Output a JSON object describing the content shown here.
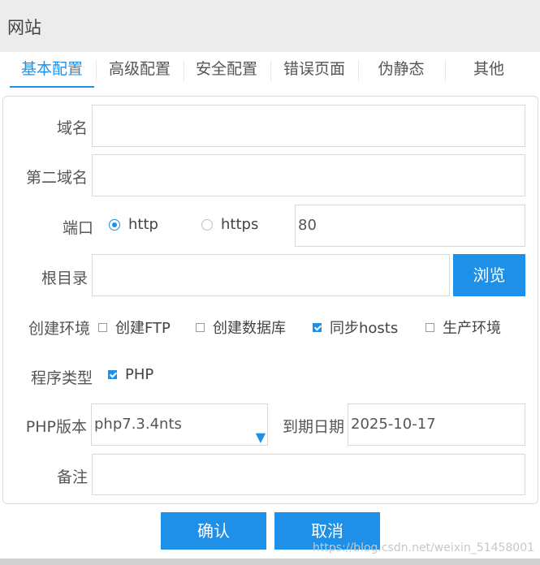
{
  "window": {
    "title": "网站"
  },
  "tabs": [
    {
      "label": "基本配置",
      "active": true
    },
    {
      "label": "高级配置",
      "active": false
    },
    {
      "label": "安全配置",
      "active": false
    },
    {
      "label": "错误页面",
      "active": false
    },
    {
      "label": "伪静态",
      "active": false
    },
    {
      "label": "其他",
      "active": false
    }
  ],
  "form": {
    "domain": {
      "label": "域名",
      "value": ""
    },
    "second_domain": {
      "label": "第二域名",
      "value": ""
    },
    "port": {
      "label": "端口",
      "options": [
        {
          "label": "http",
          "selected": true
        },
        {
          "label": "https",
          "selected": false
        }
      ],
      "value": "80"
    },
    "root_dir": {
      "label": "根目录",
      "value": "",
      "browse_label": "浏览"
    },
    "env": {
      "label": "创建环境",
      "options": [
        {
          "label": "创建FTP",
          "checked": false
        },
        {
          "label": "创建数据库",
          "checked": false
        },
        {
          "label": "同步hosts",
          "checked": true
        },
        {
          "label": "生产环境",
          "checked": false
        }
      ]
    },
    "program_type": {
      "label": "程序类型",
      "options": [
        {
          "label": "PHP",
          "checked": true
        }
      ]
    },
    "php_version": {
      "label": "PHP版本",
      "value": "php7.3.4nts"
    },
    "expire_date": {
      "label": "到期日期",
      "value": "2025-10-17"
    },
    "remark": {
      "label": "备注",
      "value": ""
    }
  },
  "actions": {
    "confirm": "确认",
    "cancel": "取消"
  },
  "watermark": "https://blog.csdn.net/weixin_51458001",
  "colors": {
    "accent": "#1e90e8",
    "titlebar": "#ececec"
  }
}
